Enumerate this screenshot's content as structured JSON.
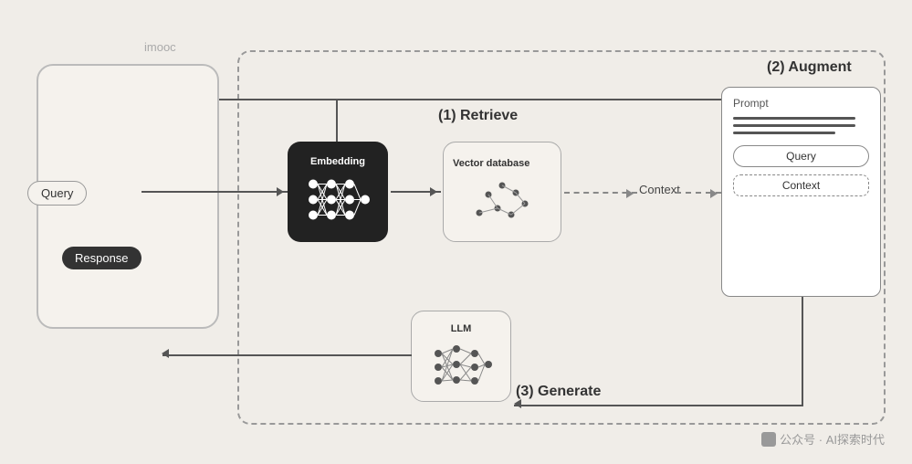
{
  "watermark": {
    "icon": "wechat-icon",
    "text": "公众号 · AI探索时代"
  },
  "imooc_label": "imooc",
  "query_label": "Query",
  "response_label": "Response",
  "embedding_label": "Embedding",
  "vdb_label": "Vector database",
  "context_label": "Context",
  "prompt_label": "Prompt",
  "prompt_query_label": "Query",
  "prompt_context_label": "Context",
  "llm_label": "LLM",
  "section_retrieve": "(1) Retrieve",
  "section_augment": "(2) Augment",
  "section_generate": "(3) Generate"
}
